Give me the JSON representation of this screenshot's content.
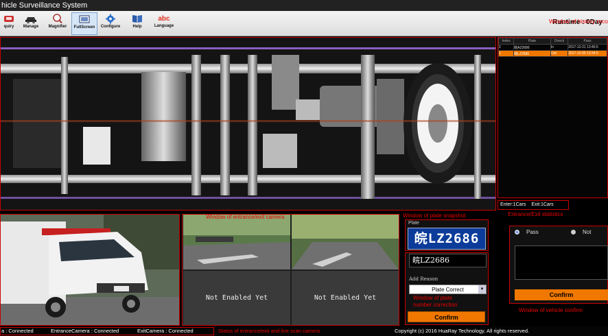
{
  "window": {
    "title": "hicle Surveillance System"
  },
  "toolbar": {
    "items": [
      {
        "label": "quiry",
        "icon": "query-icon"
      },
      {
        "label": "Manage",
        "icon": "car-manage-icon"
      },
      {
        "label": "Magnifier",
        "icon": "magnifier-icon"
      },
      {
        "label": "FullScreen",
        "icon": "fullscreen-icon",
        "active": true
      },
      {
        "label": "Configure",
        "icon": "gear-icon"
      },
      {
        "label": "Help",
        "icon": "book-icon"
      },
      {
        "label": "Language",
        "icon": "abc-icon",
        "glyph": "abc"
      }
    ],
    "runtime": "Runtime :   0Day"
  },
  "annotations": {
    "history": "Window of history reco",
    "plate_snapshot": "Window of plate snapshot",
    "entrance_exit": "Entrance/Exit statistics",
    "entrance_exit_camera": "Window of entrance/exit camera",
    "plate_correction_1": "Window of plate",
    "plate_correction_2": "number correction",
    "vehicle_confirm": "Window of vehicle confirm",
    "status": "Status of entrance/exit and line scan camera"
  },
  "history": {
    "columns": [
      "Index",
      "Plate",
      "Directi",
      "Pass"
    ],
    "rows": [
      {
        "index": "2",
        "plate": "皖AZ2686",
        "direction": "In",
        "time": "2017-12-21 13:45:5",
        "selected": false
      },
      {
        "index": "1",
        "plate": "皖LZ2686",
        "direction": "Out",
        "time": "2017-12-05 13:34:5",
        "selected": true
      }
    ]
  },
  "counts": {
    "enter": "Enter:1Cars",
    "exit": "Exit:1Cars"
  },
  "entexit": {
    "left_placeholder": "Not Enabled Yet",
    "right_placeholder": "Not Enabled Yet"
  },
  "plate": {
    "tag": "Plate",
    "number": "皖LZ2686",
    "corrected_text": "皖LZ2686",
    "add_reason_label": "Add Reason",
    "reason_selected": "Plate Correct",
    "confirm": "Confirm"
  },
  "vehicle_confirm": {
    "pass": "Pass",
    "not": "Not",
    "confirm": "Confirm"
  },
  "status": {
    "line_scan": "a : Connected",
    "entrance": "EntranceCamera : Connected",
    "exit": "ExitCamera : Connected",
    "copyright": "Copyright (c) 2016 HuaRay Technology. All rights reserved."
  },
  "colors": {
    "accent": "#f07800",
    "annotation_red": "#e00000",
    "plate_blue": "#0c3c9a"
  }
}
